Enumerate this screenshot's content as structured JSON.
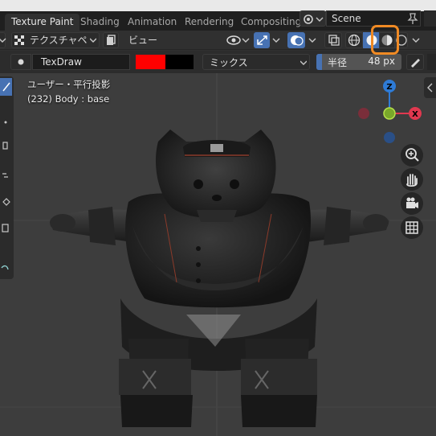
{
  "workspace_tabs": [
    {
      "label": "Texture Paint",
      "active": true
    },
    {
      "label": "Shading",
      "active": false
    },
    {
      "label": "Animation",
      "active": false
    },
    {
      "label": "Rendering",
      "active": false
    },
    {
      "label": "Compositing",
      "active": false
    }
  ],
  "scene": {
    "name": "Scene"
  },
  "header1": {
    "mode_label": "テクスチャペ",
    "view_menu": "ビュー"
  },
  "header2": {
    "brush_name": "TexDraw",
    "blend_mode": "ミックス",
    "radius_label": "半径",
    "radius_value": "48 px",
    "color_primary": "#ff0000",
    "color_secondary": "#000000"
  },
  "viewport": {
    "view_name": "ユーザー・平行投影",
    "object_info": "(232) Body : base",
    "gizmo": {
      "z_label": "Z",
      "x_label": "X"
    }
  },
  "colors": {
    "accent": "#4772b3",
    "highlight": "#f08a24",
    "axis_x": "#e0384f",
    "axis_y": "#7aa82a",
    "axis_z": "#2e7bd6"
  }
}
